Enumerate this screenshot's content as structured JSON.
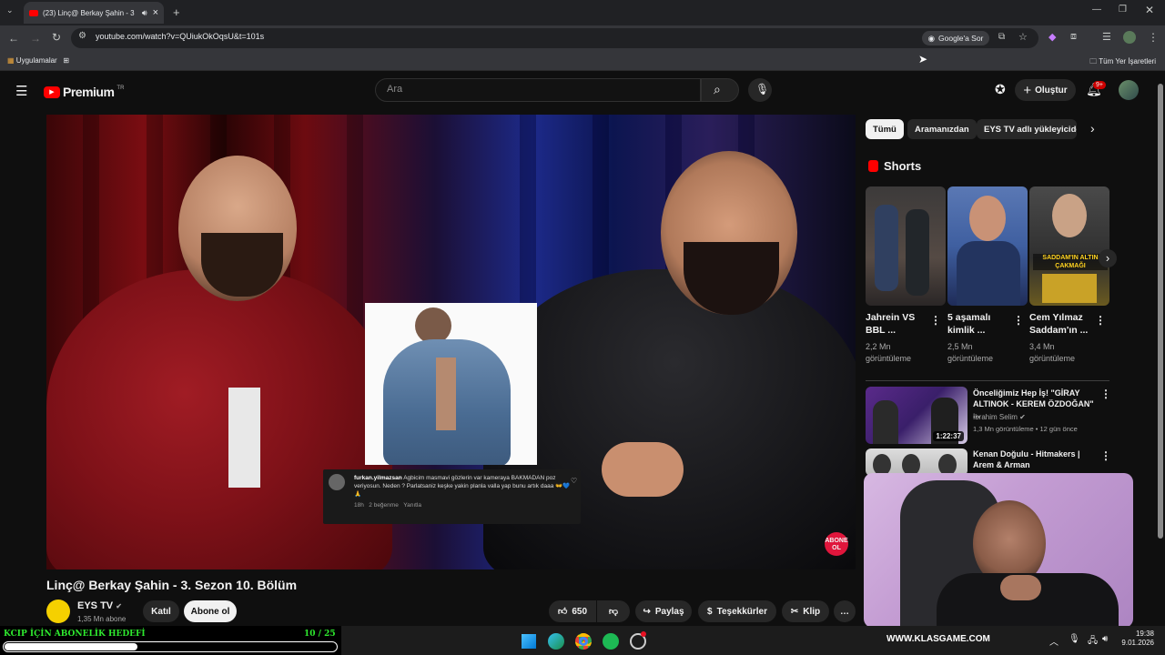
{
  "browser": {
    "tab_title": "(23) Linç@ Berkay Şahin - 3",
    "tab_close": "×",
    "new_tab": "+",
    "url": "youtube.com/watch?v=QUiukOkOqsU&t=101s",
    "ask_google": "Google'a Sor",
    "bookmarks_apps": "Uygulamalar",
    "bookmarks_all": "Tüm Yer İşaretleri"
  },
  "youtube": {
    "logo": "Premium",
    "logo_region": "TR",
    "search_placeholder": "Ara",
    "create_label": "Oluştur",
    "notif_badge": "9+"
  },
  "video": {
    "title": "Linç@ Berkay Şahin - 3. Sezon 10. Bölüm",
    "overlay_comment": {
      "user": "furkan.yilmazsan",
      "text": "Agbicim masmavi gözlerin var kameraya BAKMADAN poz veriyosun. Neden ? Parlatsaniz keşke yakin planla valla yap bunu artık daaa 👐💙🙏",
      "age": "18h",
      "likes": "2 beğenme",
      "reply": "Yanıtla"
    },
    "abone_badge": "ABONE OL"
  },
  "channel": {
    "name": "EYS TV",
    "subs": "1,35 Mn abone",
    "join": "Katıl",
    "subscribe": "Abone ol"
  },
  "actions": {
    "likes": "650",
    "share": "Paylaş",
    "thanks": "Teşekkürler",
    "clip": "Klip",
    "more": "…"
  },
  "chips": [
    "Tümü",
    "Aramanızdan",
    "EYS TV adlı yükleyiciden"
  ],
  "shorts": {
    "header": "Shorts",
    "items": [
      {
        "title": "Jahrein VS BBL ...",
        "views": "2,2 Mn görüntüleme"
      },
      {
        "title": "5 aşamalı kimlik ...",
        "views": "2,5 Mn görüntüleme"
      },
      {
        "title": "Cem Yılmaz Saddam'ın ...",
        "views": "3,4 Mn görüntüleme",
        "thumb_caption": "SADDAM'IN ALTIN ÇAKMAĞI"
      }
    ]
  },
  "recommended": [
    {
      "title": "Önceliğimiz Hep İş! \"GİRAY ALTINOK - KEREM ÖZDOĞAN\" ...",
      "channel": "İbrahim Selim",
      "meta": "1,3 Mn görüntüleme • 12 gün önce",
      "duration": "1:22:37"
    },
    {
      "title": "Kenan Doğulu - Hitmakers | Arem & Arman",
      "channel": "",
      "meta": "",
      "duration": ""
    }
  ],
  "stream_hud": {
    "goal_label": "KCIP İÇİN ABONELİK HEDEFİ",
    "goal_count": "10  / 25",
    "goal_progress": 0.4,
    "website": "WWW.KLASGAME.COM"
  },
  "taskbar": {
    "time": "19:38",
    "date": "9.01.2026"
  },
  "colors": {
    "accent_red": "#ff0000",
    "hud_green": "#2ee82e"
  }
}
